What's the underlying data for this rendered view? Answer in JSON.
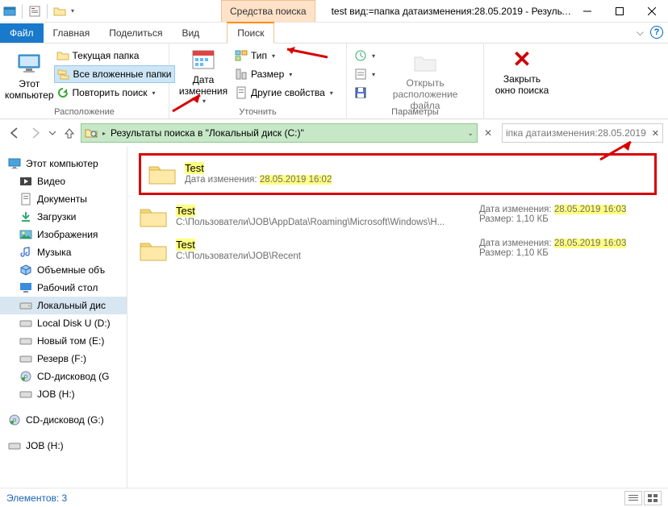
{
  "window": {
    "tools_tab": "Средства поиска",
    "title": "test вид:=папка датаизменения:28.05.2019 - Результа..."
  },
  "tabs": {
    "file": "Файл",
    "home": "Главная",
    "share": "Поделиться",
    "view": "Вид",
    "search": "Поиск"
  },
  "ribbon": {
    "this_pc": "Этот\nкомпьютер",
    "current_folder": "Текущая папка",
    "all_subfolders": "Все вложенные папки",
    "repeat_search": "Повторить поиск",
    "group_location": "Расположение",
    "date_modified": "Дата\nизменения",
    "type": "Тип",
    "size": "Размер",
    "other_props": "Другие свойства",
    "group_refine": "Уточнить",
    "open_location": "Открыть\nрасположение файла",
    "close_search": "Закрыть\nокно поиска",
    "group_params": "Параметры"
  },
  "address": {
    "text": "Результаты поиска в \"Локальный диск (C:)\"",
    "search_text": "іпка датаизменения:28.05.2019"
  },
  "nav": {
    "this_pc": "Этот компьютер",
    "video": "Видео",
    "documents": "Документы",
    "downloads": "Загрузки",
    "pictures": "Изображения",
    "music": "Музыка",
    "volumes": "Объемные объ",
    "desktop": "Рабочий стол",
    "local_disk_c": "Локальный дис",
    "local_disk_u": "Local Disk U (D:)",
    "new_volume": "Новый том (E:)",
    "reserve": "Резерв (F:)",
    "cd_g": "CD-дисковод (G",
    "job_h": "JOB (H:)",
    "cd_g2": "CD-дисковод (G:)",
    "job_h2": "JOB (H:)"
  },
  "results": [
    {
      "name": "Test",
      "sub_label": "Дата изменения: ",
      "sub_value": "28.05.2019 16:02",
      "meta_date_label": "",
      "meta_date": "",
      "meta_size": ""
    },
    {
      "name": "Test",
      "sub": "C:\\Пользователи\\JOB\\AppData\\Roaming\\Microsoft\\Windows\\Н...",
      "meta_date_label": "Дата изменения: ",
      "meta_date": "28.05.2019 16:03",
      "meta_size_label": "Размер: ",
      "meta_size": "1,10 КБ"
    },
    {
      "name": "Test",
      "sub": "C:\\Пользователи\\JOB\\Recent",
      "meta_date_label": "Дата изменения: ",
      "meta_date": "28.05.2019 16:03",
      "meta_size_label": "Размер: ",
      "meta_size": "1,10 КБ"
    }
  ],
  "status": {
    "count_label": "Элементов: ",
    "count": "3"
  }
}
